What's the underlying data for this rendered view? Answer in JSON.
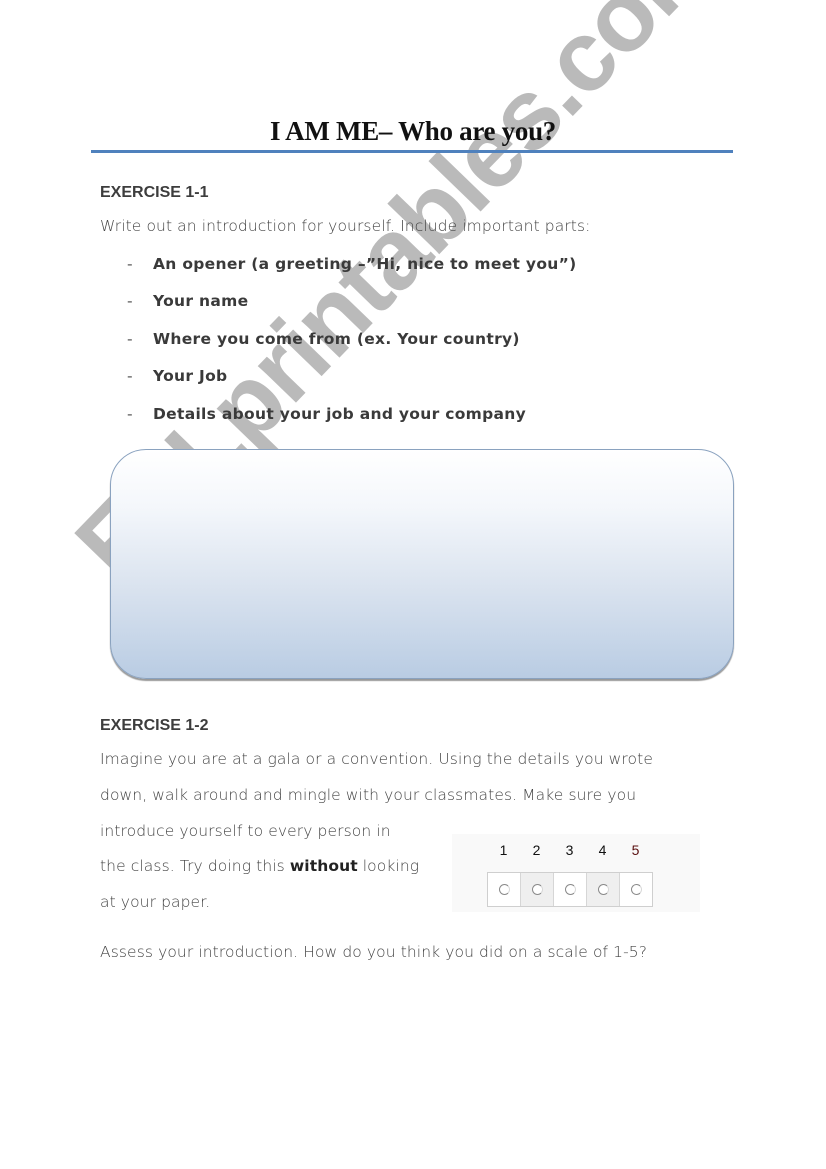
{
  "title": "I AM ME– Who are you?",
  "colors": {
    "title_rule": "#4f81bd",
    "box_gradient_bottom": "#b9cce3"
  },
  "exercise1": {
    "heading": "EXERCISE 1-1",
    "instruction": "Write out an introduction for yourself. Include important parts:",
    "list": [
      "An opener (a greeting –”Hi, nice to meet you”)",
      "Your name",
      "Where you come from (ex. Your country)",
      "Your Job",
      "Details about your job and your company"
    ],
    "bullet": "-"
  },
  "exercise2": {
    "heading": "EXERCISE 1-2",
    "lines": [
      "Imagine you are at a gala or a convention. Using the details you wrote",
      "down, walk around and mingle with your classmates. Make sure you",
      "introduce yourself to every person in"
    ],
    "line4_before": "the class. Try doing this ",
    "line4_bold": "without",
    "line4_after": " looking",
    "line5": "at your paper.",
    "assess": "Assess your introduction. How do you think you did on a scale of 1-5?"
  },
  "rating": {
    "labels": [
      "1",
      "2",
      "3",
      "4",
      "5"
    ],
    "selected": null
  },
  "watermark": "ESLprintables.com"
}
